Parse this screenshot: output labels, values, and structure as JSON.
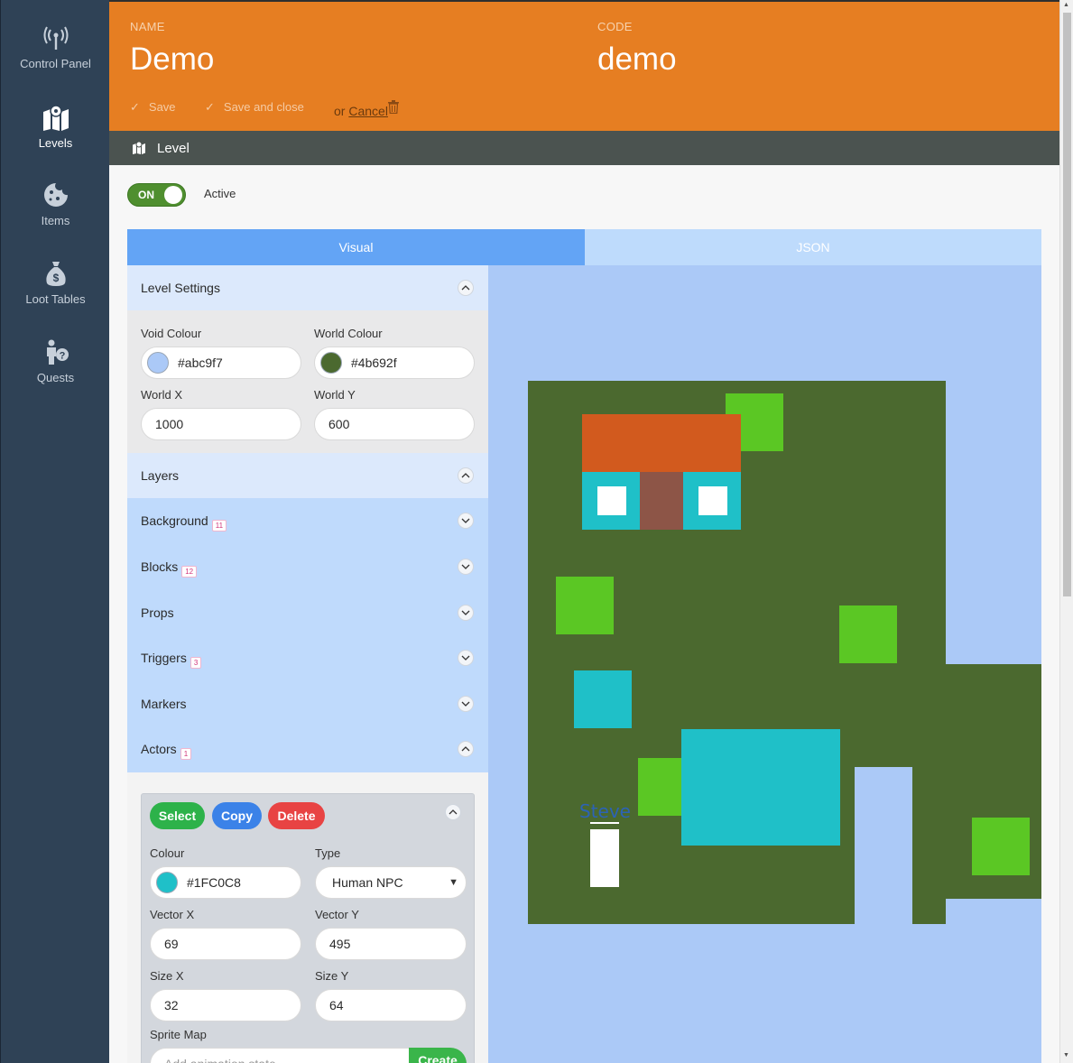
{
  "sidebar": {
    "items": [
      {
        "label": "Control Panel",
        "icon": "antenna-icon"
      },
      {
        "label": "Levels",
        "icon": "map-icon",
        "active": true
      },
      {
        "label": "Items",
        "icon": "cookie-icon"
      },
      {
        "label": "Loot Tables",
        "icon": "money-bag-icon"
      },
      {
        "label": "Quests",
        "icon": "person-question-icon"
      }
    ]
  },
  "header": {
    "name_label": "NAME",
    "name_value": "Demo",
    "code_label": "CODE",
    "code_value": "demo",
    "save_label": "Save",
    "save_close_label": "Save and close",
    "or_label": "or",
    "cancel_label": "Cancel",
    "accent": "#e67e22"
  },
  "breadcrumb": {
    "label": "Level"
  },
  "toggle": {
    "state_label": "ON",
    "active_label": "Active"
  },
  "tabs": [
    {
      "label": "Visual",
      "selected": true
    },
    {
      "label": "JSON",
      "selected": false
    }
  ],
  "level_settings": {
    "title": "Level Settings",
    "void_colour_label": "Void Colour",
    "void_colour_value": "#abc9f7",
    "world_colour_label": "World Colour",
    "world_colour_value": "#4b692f",
    "world_x_label": "World X",
    "world_x_value": "1000",
    "world_y_label": "World Y",
    "world_y_value": "600"
  },
  "layers": {
    "title": "Layers",
    "items": [
      {
        "name": "Background",
        "count": "11"
      },
      {
        "name": "Blocks",
        "count": "12"
      },
      {
        "name": "Props",
        "count": ""
      },
      {
        "name": "Triggers",
        "count": "3"
      },
      {
        "name": "Markers",
        "count": ""
      },
      {
        "name": "Actors",
        "count": "1"
      }
    ]
  },
  "actor": {
    "select_label": "Select",
    "copy_label": "Copy",
    "delete_label": "Delete",
    "colour_label": "Colour",
    "colour_value": "#1FC0C8",
    "type_label": "Type",
    "type_value": "Human NPC",
    "vector_x_label": "Vector X",
    "vector_x_value": "69",
    "vector_y_label": "Vector Y",
    "vector_y_value": "495",
    "size_x_label": "Size X",
    "size_x_value": "32",
    "size_y_label": "Size Y",
    "size_y_value": "64",
    "sprite_map_label": "Sprite Map",
    "animation_placeholder": "Add animation state",
    "create_label": "Create"
  },
  "canvas": {
    "void_colour": "#abc9f7",
    "world_colour": "#4b692f",
    "actor_name": "Steve"
  }
}
